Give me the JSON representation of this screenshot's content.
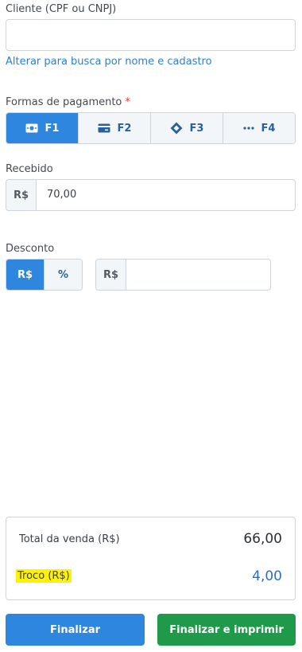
{
  "cliente": {
    "label": "Cliente (CPF ou CNPJ)",
    "value": "",
    "switch_link": "Alterar para busca por nome e cadastro"
  },
  "pagamento": {
    "label": "Formas de pagamento",
    "required_mark": "*",
    "options": [
      {
        "label": "F1",
        "icon": "cash-icon",
        "active": true
      },
      {
        "label": "F2",
        "icon": "card-icon",
        "active": false
      },
      {
        "label": "F3",
        "icon": "pix-icon",
        "active": false
      },
      {
        "label": "F4",
        "icon": "more-icon",
        "active": false
      }
    ]
  },
  "recebido": {
    "label": "Recebido",
    "prefix": "R$",
    "value": "70,00"
  },
  "desconto": {
    "label": "Desconto",
    "mode_currency": "R$",
    "mode_percent": "%",
    "prefix": "R$",
    "value": ""
  },
  "resumo": {
    "total_label": "Total da venda (R$)",
    "total_value": "66,00",
    "troco_label": "Troco (R$)",
    "troco_value": "4,00"
  },
  "actions": {
    "finalizar": "Finalizar",
    "finalizar_imprimir": "Finalizar e imprimir"
  },
  "colors": {
    "primary": "#2e86de",
    "success": "#1f9a4a",
    "highlight": "#fff200"
  }
}
